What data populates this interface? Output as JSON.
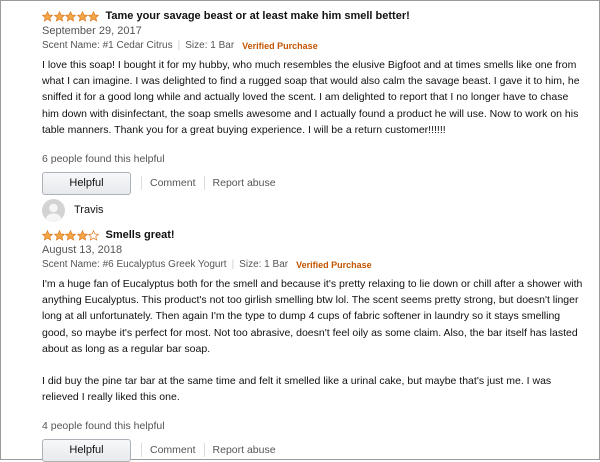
{
  "star_color": "#f3a847",
  "star_empty_stroke": "#de7921",
  "reviews": [
    {
      "reviewer": "",
      "rating": 5,
      "title": "Tame your savage beast or at least make him smell better!",
      "date": "September 29, 2017",
      "scent": "Scent Name: #1 Cedar Citrus",
      "size": "Size: 1 Bar",
      "verified": "Verified Purchase",
      "paragraphs": [
        "I love this soap! I bought it for my hubby, who much resembles the elusive Bigfoot and at times smells like one from what I can imagine. I was delighted to find a rugged soap that would also calm the savage beast. I gave it to him, he sniffed it for a good long while and actually loved the scent. I am delighted to report that I no longer have to chase him down with disinfectant, the soap smells awesome and I actually found a product he will use. Now to work on his table manners. Thank you for a great buying experience. I will be a return customer!!!!!!"
      ],
      "helpful_count": "6 people found this helpful",
      "helpful_label": "Helpful",
      "comment_label": "Comment",
      "report_label": "Report abuse"
    },
    {
      "reviewer": "Travis",
      "rating": 4,
      "title": "Smells great!",
      "date": "August 13, 2018",
      "scent": "Scent Name: #6 Eucalyptus Greek Yogurt",
      "size": "Size: 1 Bar",
      "verified": "Verified Purchase",
      "paragraphs": [
        "I'm a huge fan of Eucalyptus both for the smell and because it's pretty relaxing to lie down or chill after a shower with anything Eucalyptus. This product's not too girlish smelling btw lol. The scent seems pretty strong, but doesn't linger long at all unfortunately. Then again I'm the type to dump 4 cups of fabric softener in laundry so it stays smelling good, so maybe it's perfect for most. Not too abrasive, doesn't feel oily as some claim. Also, the bar itself has lasted about as long as a regular bar soap.",
        "I did buy the pine tar bar at the same time and felt it smelled like a urinal cake, but maybe that's just me. I was relieved I really liked this one."
      ],
      "helpful_count": "4 people found this helpful",
      "helpful_label": "Helpful",
      "comment_label": "Comment",
      "report_label": "Report abuse"
    }
  ]
}
